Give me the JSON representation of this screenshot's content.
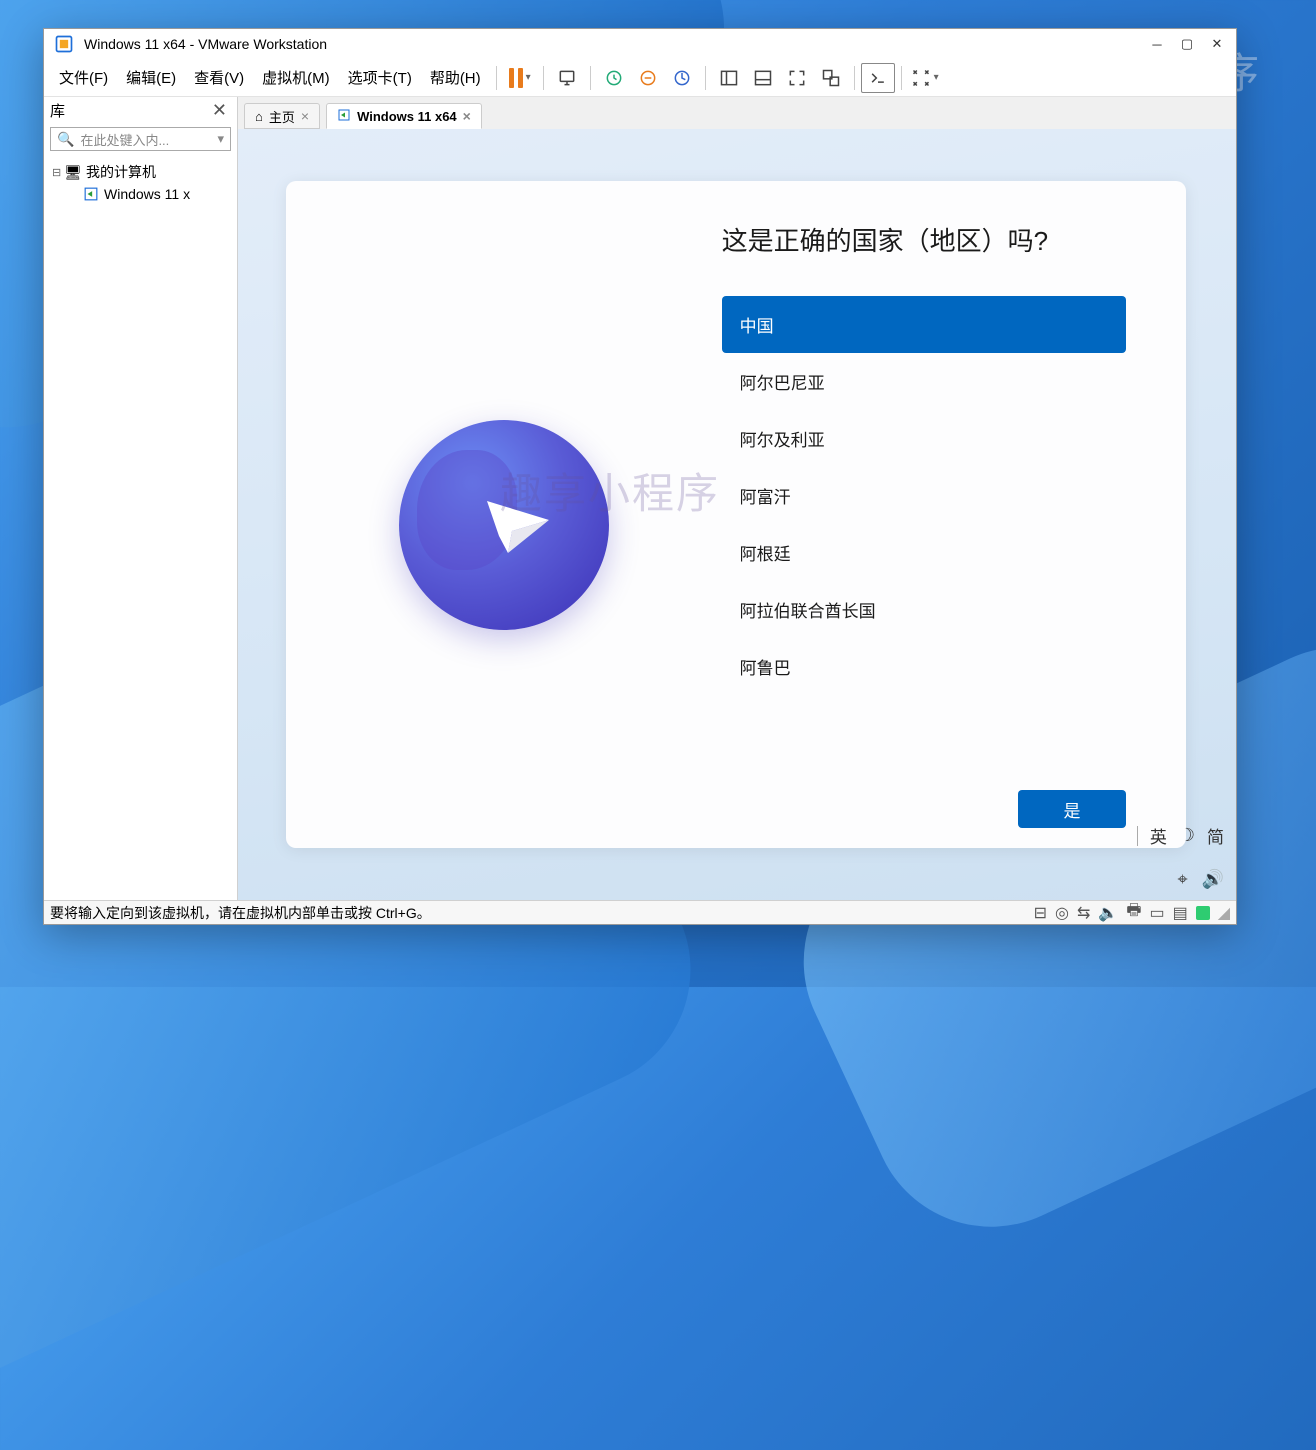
{
  "window": {
    "title": "Windows 11 x64 - VMware Workstation"
  },
  "menu": {
    "file": "文件(F)",
    "edit": "编辑(E)",
    "view": "查看(V)",
    "vm": "虚拟机(M)",
    "tabs": "选项卡(T)",
    "help": "帮助(H)"
  },
  "sidebar": {
    "title": "库",
    "search_placeholder": "在此处键入内...",
    "tree": {
      "root": "我的计算机",
      "child": "Windows 11 x"
    }
  },
  "tabs": {
    "home": "主页",
    "vm": "Windows 11 x64"
  },
  "oobe": {
    "question": "这是正确的国家（地区）吗?",
    "countries": [
      "中国",
      "阿尔巴尼亚",
      "阿尔及利亚",
      "阿富汗",
      "阿根廷",
      "阿拉伯联合酋长国",
      "阿鲁巴"
    ],
    "confirm": "是"
  },
  "ime": {
    "lang": "英",
    "mode": "简"
  },
  "statusbar": {
    "hint": "要将输入定向到该虚拟机，请在虚拟机内部单击或按 Ctrl+G。"
  }
}
